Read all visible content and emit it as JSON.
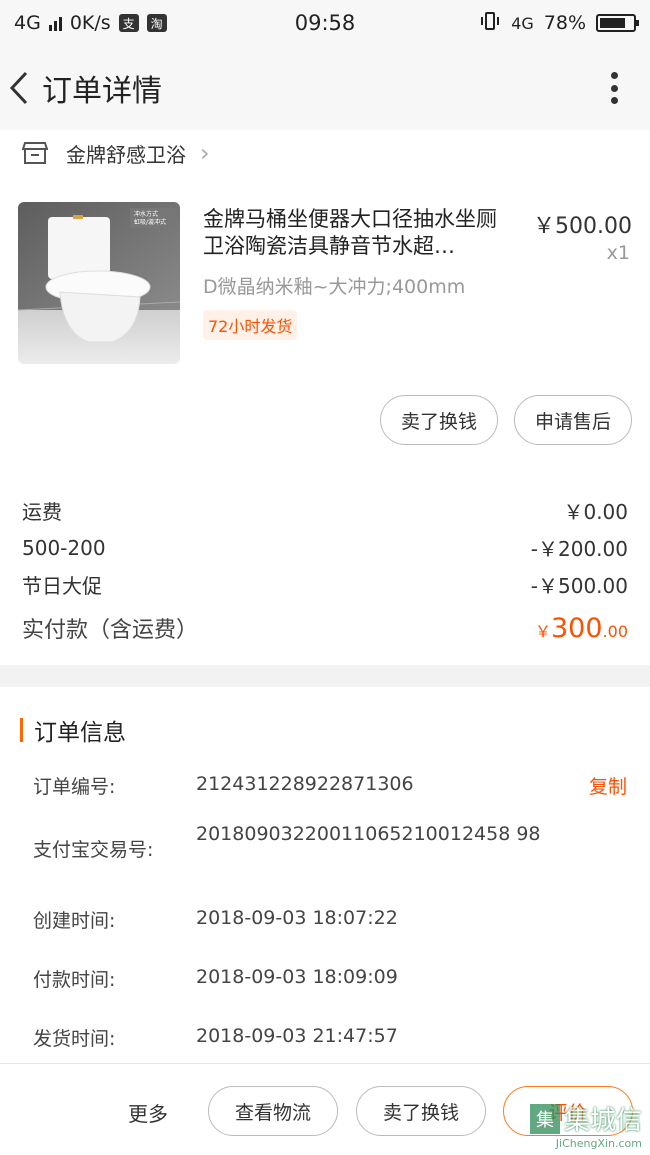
{
  "status_bar": {
    "network": "4G",
    "speed": "0K/s",
    "time": "09:58",
    "network2": "4G",
    "battery_text": "78%",
    "battery_level": 0.78,
    "app_icon_1": "支",
    "app_icon_2": "淘"
  },
  "app_bar": {
    "title": "订单详情"
  },
  "shop": {
    "name": "金牌舒感卫浴",
    "chevron": "›"
  },
  "product": {
    "name": "金牌马桶坐便器大口径抽水坐厕卫浴陶瓷洁具静音节水超…",
    "price": "￥500.00",
    "qty": "x1",
    "spec": "D微晶纳米釉~大冲力;400mm",
    "tag": "72小时发货",
    "image_text_1": "冲水方式",
    "image_text_2": "虹吸/漩冲式"
  },
  "item_actions": {
    "sell_label": "卖了换钱",
    "aftersale_label": "申请售后"
  },
  "fees": [
    {
      "label": "运费",
      "value": "￥0.00"
    },
    {
      "label": "500-200",
      "value": "-￥200.00"
    },
    {
      "label": "节日大促",
      "value": "-￥500.00"
    }
  ],
  "total": {
    "label": "实付款（含运费）",
    "currency": "￥",
    "int": "300",
    "dec": ".00"
  },
  "order_info": {
    "title": "订单信息",
    "rows": [
      {
        "key": "订单编号:",
        "value": "212431228922871306"
      },
      {
        "key": "支付宝交易号:",
        "value": "20180903220011065210012458 98"
      },
      {
        "key": "创建时间:",
        "value": "2018-09-03 18:07:22"
      },
      {
        "key": "付款时间:",
        "value": "2018-09-03 18:09:09"
      },
      {
        "key": "发货时间:",
        "value": "2018-09-03 21:47:57"
      }
    ],
    "copy_label": "复制"
  },
  "bottom_bar": {
    "more_label": "更多",
    "logistics_label": "查看物流",
    "sell_label": "卖了换钱",
    "review_label": "评价"
  },
  "watermark": {
    "main": "集城信",
    "box": "集",
    "sub": "JiChengXin.com"
  },
  "colors": {
    "accent": "#ff5000",
    "background": "#f2f2f2"
  }
}
